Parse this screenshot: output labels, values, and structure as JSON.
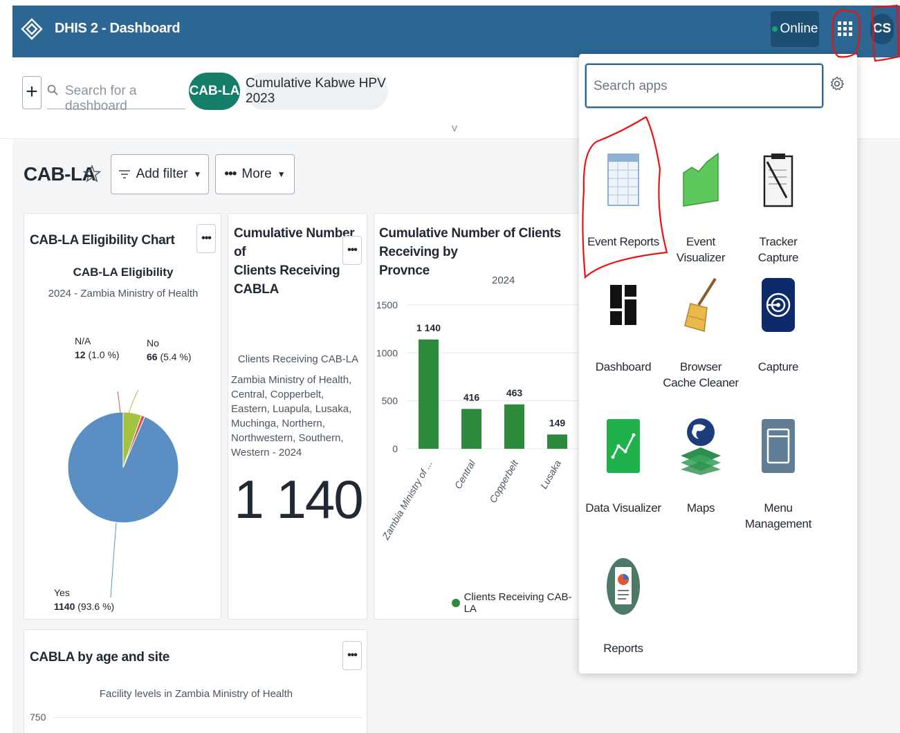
{
  "header": {
    "app_title": "DHIS 2 - Dashboard",
    "online_status": "Online",
    "user_initials": "CS"
  },
  "dashboard_bar": {
    "add_label": "+",
    "search_placeholder": "Search for a dashboard",
    "chips": [
      "CAB-LA",
      "Cumulative Kabwe HPV 2023"
    ],
    "expand_glyph": "v"
  },
  "dashboard": {
    "title": "CAB-LA",
    "filter_label": "Add filter",
    "more_label": "More"
  },
  "cards": {
    "eligibility": {
      "title": "CAB-LA Eligibility Chart",
      "chart_title": "CAB-LA Eligibility",
      "chart_subtitle": "2024 - Zambia Ministry of Health",
      "na_label": "N/A",
      "na_value": "12",
      "na_pct": "(1.0 %)",
      "no_label": "No",
      "no_value": "66",
      "no_pct": "(5.4 %)",
      "yes_label": "Yes",
      "yes_value": "1140",
      "yes_pct": "(93.6 %)"
    },
    "cumulative": {
      "title_line1": "Cumulative Number of",
      "title_line2": "Clients Receiving",
      "title_line3": "CABLA",
      "metric_label": "Clients Receiving CAB-LA",
      "metric_desc": "Zambia Ministry of Health, Central, Copperbelt, Eastern, Luapula, Lusaka, Muchinga, Northern, Northwestern, Southern, Western - 2024",
      "metric_value": "1 140"
    },
    "province": {
      "title_line1": "Cumulative Number of Clients Receiving by",
      "title_line2": "Provnce",
      "chart_subtitle": "2024",
      "legend": "Clients Receiving CAB-LA"
    },
    "age_site": {
      "title": "CABLA by age and site",
      "chart_subtitle": "Facility levels in Zambia Ministry of Health",
      "y_tick": "750"
    }
  },
  "chart_data": [
    {
      "type": "pie",
      "title": "CAB-LA Eligibility",
      "subtitle": "2024 - Zambia Ministry of Health",
      "categories": [
        "Yes",
        "No",
        "N/A"
      ],
      "values": [
        1140,
        66,
        12
      ],
      "percentages": [
        93.6,
        5.4,
        1.0
      ],
      "colors": [
        "#5b8fc4",
        "#a2c33f",
        "#d9534f"
      ]
    },
    {
      "type": "bar",
      "title": "",
      "subtitle": "2024",
      "categories": [
        "Zambia Ministry of ...",
        "Central",
        "Copperbelt",
        "Lusaka"
      ],
      "series": [
        {
          "name": "Clients Receiving CAB-LA",
          "values": [
            1140,
            416,
            463,
            149
          ]
        }
      ],
      "value_labels": [
        "1 140",
        "416",
        "463",
        "149"
      ],
      "y_ticks": [
        "1500",
        "1000",
        "500",
        "0"
      ],
      "ylim": [
        0,
        1500
      ],
      "grid": true,
      "color": "#2e8b3e",
      "legend_position": "bottom"
    }
  ],
  "apps_menu": {
    "search_placeholder": "Search apps",
    "apps": [
      {
        "label": "Event Reports",
        "icon": "table-icon"
      },
      {
        "label": "Event Visualizer",
        "icon": "area-chart-icon"
      },
      {
        "label": "Tracker Capture",
        "icon": "clipboard-icon"
      },
      {
        "label": "Dashboard",
        "icon": "dashboard-grid-icon"
      },
      {
        "label": "Browser Cache Cleaner",
        "icon": "broom-icon"
      },
      {
        "label": "Capture",
        "icon": "capture-icon"
      },
      {
        "label": "Data Visualizer",
        "icon": "line-chart-icon"
      },
      {
        "label": "Maps",
        "icon": "globe-layers-icon"
      },
      {
        "label": "Menu Management",
        "icon": "window-icon"
      },
      {
        "label": "Reports",
        "icon": "report-icon"
      }
    ]
  }
}
